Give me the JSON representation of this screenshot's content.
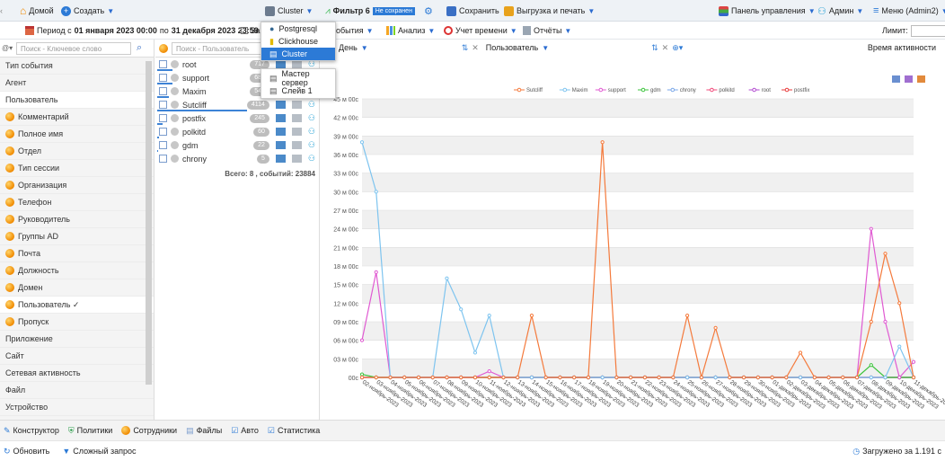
{
  "topbar": {
    "home": "Домой",
    "create": "Создать",
    "cluster": "Cluster",
    "filter": "Фильтр 6",
    "unsaved": "Не сохранен",
    "save": "Сохранить",
    "export": "Выгрузка и печать",
    "panel": "Панель управления",
    "admin": "Админ",
    "menu": "Меню (Admin2)"
  },
  "periodbar": {
    "prefix": "Период с",
    "from": "01 января 2023 00:00",
    "mid": "по",
    "to": "31 декабря 2023 23:59",
    "trunc": "За",
    "events": "обытия",
    "analysis": "Анализ",
    "timeacc": "Учет времени",
    "reports": "Отчёты",
    "limit": "Лимит:"
  },
  "dropdown": {
    "items": [
      "Postgresql",
      "Clickhouse",
      "Cluster"
    ]
  },
  "submenu": {
    "items": [
      "Мастер сервер",
      "Слейв 1"
    ]
  },
  "left": {
    "search_placeholder": "Поиск - Ключевое слово",
    "items": [
      {
        "label": "Тип события",
        "dot": false
      },
      {
        "label": "Агент",
        "dot": false
      },
      {
        "label": "Пользователь",
        "dot": false,
        "sel": true
      },
      {
        "label": "Комментарий",
        "dot": true
      },
      {
        "label": "Полное имя",
        "dot": true
      },
      {
        "label": "Отдел",
        "dot": true
      },
      {
        "label": "Тип сессии",
        "dot": true
      },
      {
        "label": "Организация",
        "dot": true
      },
      {
        "label": "Телефон",
        "dot": true
      },
      {
        "label": "Руководитель",
        "dot": true
      },
      {
        "label": "Группы AD",
        "dot": true
      },
      {
        "label": "Почта",
        "dot": true
      },
      {
        "label": "Должность",
        "dot": true
      },
      {
        "label": "Домен",
        "dot": true
      },
      {
        "label": "Пользователь ✓",
        "dot": true,
        "sel": true
      },
      {
        "label": "Пропуск",
        "dot": true
      },
      {
        "label": "Приложение",
        "dot": false
      },
      {
        "label": "Сайт",
        "dot": false
      },
      {
        "label": "Сетевая активность",
        "dot": false
      },
      {
        "label": "Файл",
        "dot": false
      },
      {
        "label": "Устройство",
        "dot": false
      }
    ]
  },
  "mid": {
    "search_placeholder": "Поиск - Пользователь",
    "users": [
      {
        "name": "root",
        "count": "717",
        "bar": 0.17
      },
      {
        "name": "support",
        "count": "685",
        "bar": 0.17
      },
      {
        "name": "Maxim",
        "count": "541",
        "bar": 0.13
      },
      {
        "name": "Sutcliff",
        "count": "4114",
        "bar": 1.0
      },
      {
        "name": "postfix",
        "count": "245",
        "bar": 0.06
      },
      {
        "name": "polkitd",
        "count": "60",
        "bar": 0.02
      },
      {
        "name": "gdm",
        "count": "22",
        "bar": 0.01
      },
      {
        "name": "chrony",
        "count": "5",
        "bar": 0.0
      }
    ],
    "total": "Всего: 8 , событий: 23884"
  },
  "chartpanel": {
    "x_selector": "День",
    "series_selector": "Пользователь",
    "measure": "Время активности"
  },
  "chart_data": {
    "type": "line",
    "ylabel": "",
    "yticks": [
      "00с",
      "03 м 00с",
      "06 м 00с",
      "09 м 00с",
      "12 м 00с",
      "15 м 00с",
      "18 м 00с",
      "21 м 00с",
      "24 м 00с",
      "27 м 00с",
      "30 м 00с",
      "33 м 00с",
      "36 м 00с",
      "39 м 00с",
      "42 м 00с",
      "45 м 00с"
    ],
    "ylim": [
      0,
      45
    ],
    "x": [
      "02-ноябрь-2023",
      "03-ноябрь-2023",
      "04-ноябрь-2023",
      "05-ноябрь-2023",
      "06-ноябрь-2023",
      "07-ноябрь-2023",
      "08-ноябрь-2023",
      "09-ноябрь-2023",
      "10-ноябрь-2023",
      "11-ноябрь-2023",
      "12-ноябрь-2023",
      "13-ноябрь-2023",
      "14-ноябрь-2023",
      "15-ноябрь-2023",
      "16-ноябрь-2023",
      "17-ноябрь-2023",
      "18-ноябрь-2023",
      "19-ноябрь-2023",
      "20-ноябрь-2023",
      "21-ноябрь-2023",
      "22-ноябрь-2023",
      "23-ноябрь-2023",
      "24-ноябрь-2023",
      "25-ноябрь-2023",
      "26-ноябрь-2023",
      "27-ноябрь-2023",
      "28-ноябрь-2023",
      "29-ноябрь-2023",
      "30-ноябрь-2023",
      "01-декабрь-2023",
      "02-декабрь-2023",
      "03-декабрь-2023",
      "04-декабрь-2023",
      "05-декабрь-2023",
      "06-декабрь-2023",
      "07-декабрь-2023",
      "08-декабрь-2023",
      "09-декабрь-2023",
      "10-декабрь-2023",
      "11-декабрь-2023"
    ],
    "series": [
      {
        "name": "Sutcliff",
        "color": "#f47a3c",
        "marker": "o",
        "values": [
          0,
          0,
          0,
          0,
          0,
          0,
          0,
          0,
          0,
          0,
          0,
          0,
          10,
          0,
          0,
          0,
          0,
          38,
          0,
          0,
          0,
          0,
          0,
          10,
          0,
          8,
          0,
          0,
          0,
          0,
          0,
          4,
          0,
          0,
          0,
          0,
          9,
          20,
          12,
          0
        ]
      },
      {
        "name": "Maxim",
        "color": "#7ec4ef",
        "marker": "o",
        "values": [
          38,
          30,
          0,
          0,
          0,
          0,
          16,
          11,
          4,
          10,
          0,
          0,
          0,
          0,
          0,
          0,
          0,
          0,
          0,
          0,
          0,
          0,
          0,
          0,
          0,
          0,
          0,
          0,
          0,
          0,
          0,
          0,
          0,
          0,
          0,
          0,
          0,
          0,
          5,
          0
        ]
      },
      {
        "name": "support",
        "color": "#e05ad2",
        "marker": "^",
        "values": [
          6,
          17,
          0,
          0,
          0,
          0,
          0,
          0,
          0,
          1,
          0,
          0,
          0,
          0,
          0,
          0,
          0,
          0,
          0,
          0,
          0,
          0,
          0,
          0,
          0,
          0,
          0,
          0,
          0,
          0,
          0,
          0,
          0,
          0,
          0,
          0,
          24,
          9,
          0,
          2.5
        ]
      },
      {
        "name": "gdm",
        "color": "#3cc43c",
        "marker": "+",
        "values": [
          0.5,
          0,
          0,
          0,
          0,
          0,
          0,
          0,
          0,
          0,
          0,
          0,
          0,
          0,
          0,
          0,
          0,
          0,
          0,
          0,
          0,
          0,
          0,
          0,
          0,
          0,
          0,
          0,
          0,
          0,
          0,
          0,
          0,
          0,
          0,
          0,
          2,
          0,
          0,
          0
        ]
      },
      {
        "name": "chrony",
        "color": "#7aa7e8",
        "marker": "o",
        "values": [
          0,
          0,
          0,
          0,
          0,
          0,
          0,
          0,
          0,
          0,
          0,
          0,
          0,
          0,
          0,
          0,
          0,
          0,
          0,
          0,
          0,
          0,
          0,
          0,
          0,
          0,
          0,
          0,
          0,
          0,
          0,
          0,
          0,
          0,
          0,
          0,
          0,
          0,
          0,
          0
        ]
      },
      {
        "name": "polkitd",
        "color": "#f0487a",
        "marker": "s",
        "values": [
          0,
          0,
          0,
          0,
          0,
          0,
          0,
          0,
          0,
          0,
          0,
          0,
          0,
          0,
          0,
          0,
          0,
          0,
          0,
          0,
          0,
          0,
          0,
          0,
          0,
          0,
          0,
          0,
          0,
          0,
          0,
          0,
          0,
          0,
          0,
          0,
          0,
          0,
          0,
          0
        ]
      },
      {
        "name": "root",
        "color": "#b24ad0",
        "marker": "^",
        "values": [
          0,
          0,
          0,
          0,
          0,
          0,
          0,
          0,
          0,
          0,
          0,
          0,
          0,
          0,
          0,
          0,
          0,
          0,
          0,
          0,
          0,
          0,
          0,
          0,
          0,
          0,
          0,
          0,
          0,
          0,
          0,
          0,
          0,
          0,
          0,
          0,
          0,
          0,
          0,
          0
        ]
      },
      {
        "name": "postfix",
        "color": "#e83a3a",
        "marker": "o",
        "values": [
          0,
          0,
          0,
          0,
          0,
          0,
          0,
          0,
          0,
          0,
          0,
          0,
          0,
          0,
          0,
          0,
          0,
          0,
          0,
          0,
          0,
          0,
          0,
          0,
          0,
          0,
          0,
          0,
          0,
          0,
          0,
          0,
          0,
          0,
          0,
          0,
          0,
          0,
          0,
          0
        ]
      }
    ],
    "legend": "top",
    "grid": true
  },
  "bottomtabs": [
    "Конструктор",
    "Политики",
    "Сотрудники",
    "Файлы",
    "Авто",
    "Статистика"
  ],
  "status": {
    "refresh": "Обновить",
    "complex": "Сложный запрос",
    "loaded": "Загружено за 1.191 с"
  },
  "colors": {
    "accent": "#2c7ad6",
    "topbar": "#eef2f6"
  }
}
